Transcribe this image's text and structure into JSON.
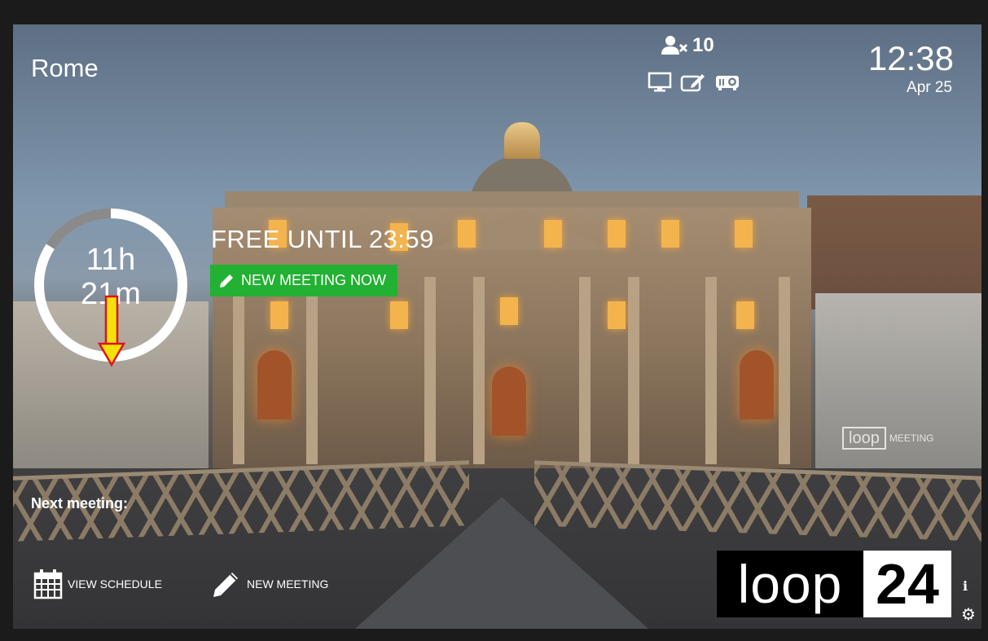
{
  "room": {
    "name": "Rome"
  },
  "clock": {
    "time": "12:38",
    "date": "Apr 25"
  },
  "capacity": {
    "count": "10",
    "icon": "people-icon"
  },
  "amenities": [
    {
      "icon": "display-icon"
    },
    {
      "icon": "whiteboard-icon"
    },
    {
      "icon": "projector-icon"
    }
  ],
  "availability": {
    "status": "FREE UNTIL 23:59",
    "remaining_hours": "11h",
    "remaining_minutes": "21m",
    "remaining_hours_fraction": 0.84,
    "new_meeting_now_label": "NEW MEETING NOW",
    "accent_color": "#22b132"
  },
  "next_meeting": {
    "label": "Next meeting:"
  },
  "actions": {
    "view_schedule_label": "VIEW SCHEDULE",
    "new_meeting_label": "NEW MEETING"
  },
  "watermark": {
    "loop": "loop",
    "meeting": "MEETING"
  },
  "logo": {
    "word": "loop",
    "number": "24"
  },
  "corner": {
    "info": "i",
    "settings_icon": "gear-icon"
  }
}
